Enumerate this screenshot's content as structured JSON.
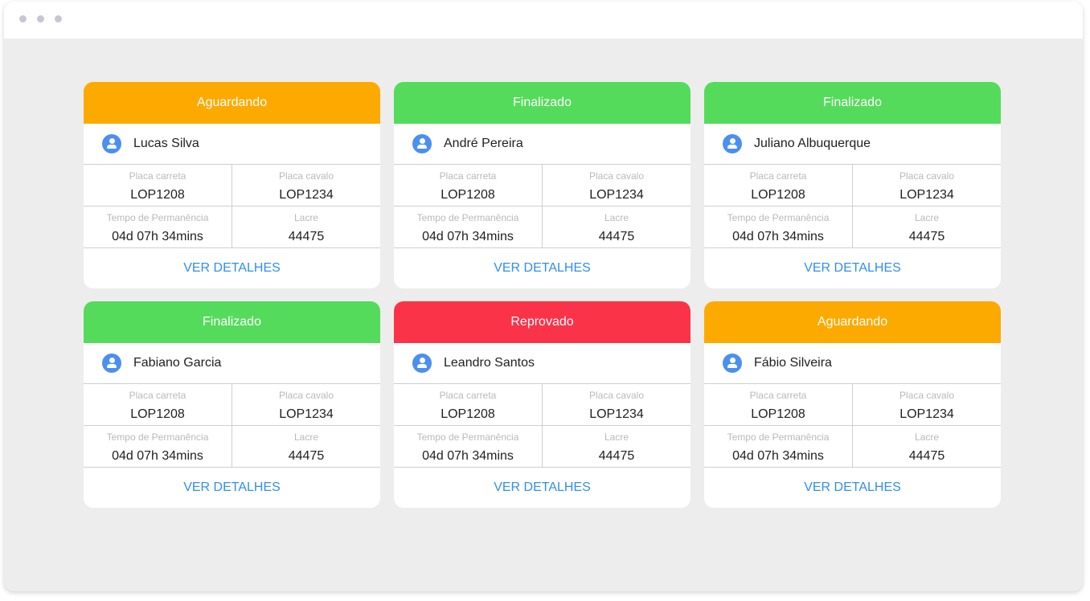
{
  "cards": [
    {
      "status": "Aguardando",
      "status_color": "#fdaa00",
      "name": "Lucas Silva",
      "placa_carreta_label": "Placa carreta",
      "placa_carreta": "LOP1208",
      "placa_cavalo_label": "Placa cavalo",
      "placa_cavalo": "LOP1234",
      "tempo_label": "Tempo de Permanência",
      "tempo": "04d 07h 34mins",
      "lacre_label": "Lacre",
      "lacre": "44475",
      "details_label": "VER DETALHES"
    },
    {
      "status": "Finalizado",
      "status_color": "#55db5b",
      "name": "André Pereira",
      "placa_carreta_label": "Placa carreta",
      "placa_carreta": "LOP1208",
      "placa_cavalo_label": "Placa cavalo",
      "placa_cavalo": "LOP1234",
      "tempo_label": "Tempo de Permanência",
      "tempo": "04d 07h 34mins",
      "lacre_label": "Lacre",
      "lacre": "44475",
      "details_label": "VER DETALHES"
    },
    {
      "status": "Finalizado",
      "status_color": "#55db5b",
      "name": "Juliano Albuquerque",
      "placa_carreta_label": "Placa carreta",
      "placa_carreta": "LOP1208",
      "placa_cavalo_label": "Placa cavalo",
      "placa_cavalo": "LOP1234",
      "tempo_label": "Tempo de Permanência",
      "tempo": "04d 07h 34mins",
      "lacre_label": "Lacre",
      "lacre": "44475",
      "details_label": "VER DETALHES"
    },
    {
      "status": "Finalizado",
      "status_color": "#55db5b",
      "name": "Fabiano Garcia",
      "placa_carreta_label": "Placa carreta",
      "placa_carreta": "LOP1208",
      "placa_cavalo_label": "Placa cavalo",
      "placa_cavalo": "LOP1234",
      "tempo_label": "Tempo de Permanência",
      "tempo": "04d 07h 34mins",
      "lacre_label": "Lacre",
      "lacre": "44475",
      "details_label": "VER DETALHES"
    },
    {
      "status": "Reprovado",
      "status_color": "#fb3348",
      "name": "Leandro Santos",
      "placa_carreta_label": "Placa carreta",
      "placa_carreta": "LOP1208",
      "placa_cavalo_label": "Placa cavalo",
      "placa_cavalo": "LOP1234",
      "tempo_label": "Tempo de Permanência",
      "tempo": "04d 07h 34mins",
      "lacre_label": "Lacre",
      "lacre": "44475",
      "details_label": "VER DETALHES"
    },
    {
      "status": "Aguardando",
      "status_color": "#fdaa00",
      "name": "Fábio Silveira",
      "placa_carreta_label": "Placa carreta",
      "placa_carreta": "LOP1208",
      "placa_cavalo_label": "Placa cavalo",
      "placa_cavalo": "LOP1234",
      "tempo_label": "Tempo de Permanência",
      "tempo": "04d 07h 34mins",
      "lacre_label": "Lacre",
      "lacre": "44475",
      "details_label": "VER DETALHES"
    }
  ],
  "icons": {
    "avatar": "user-circle-icon"
  },
  "colors": {
    "link": "#2f8ff0",
    "background": "#ededed"
  }
}
